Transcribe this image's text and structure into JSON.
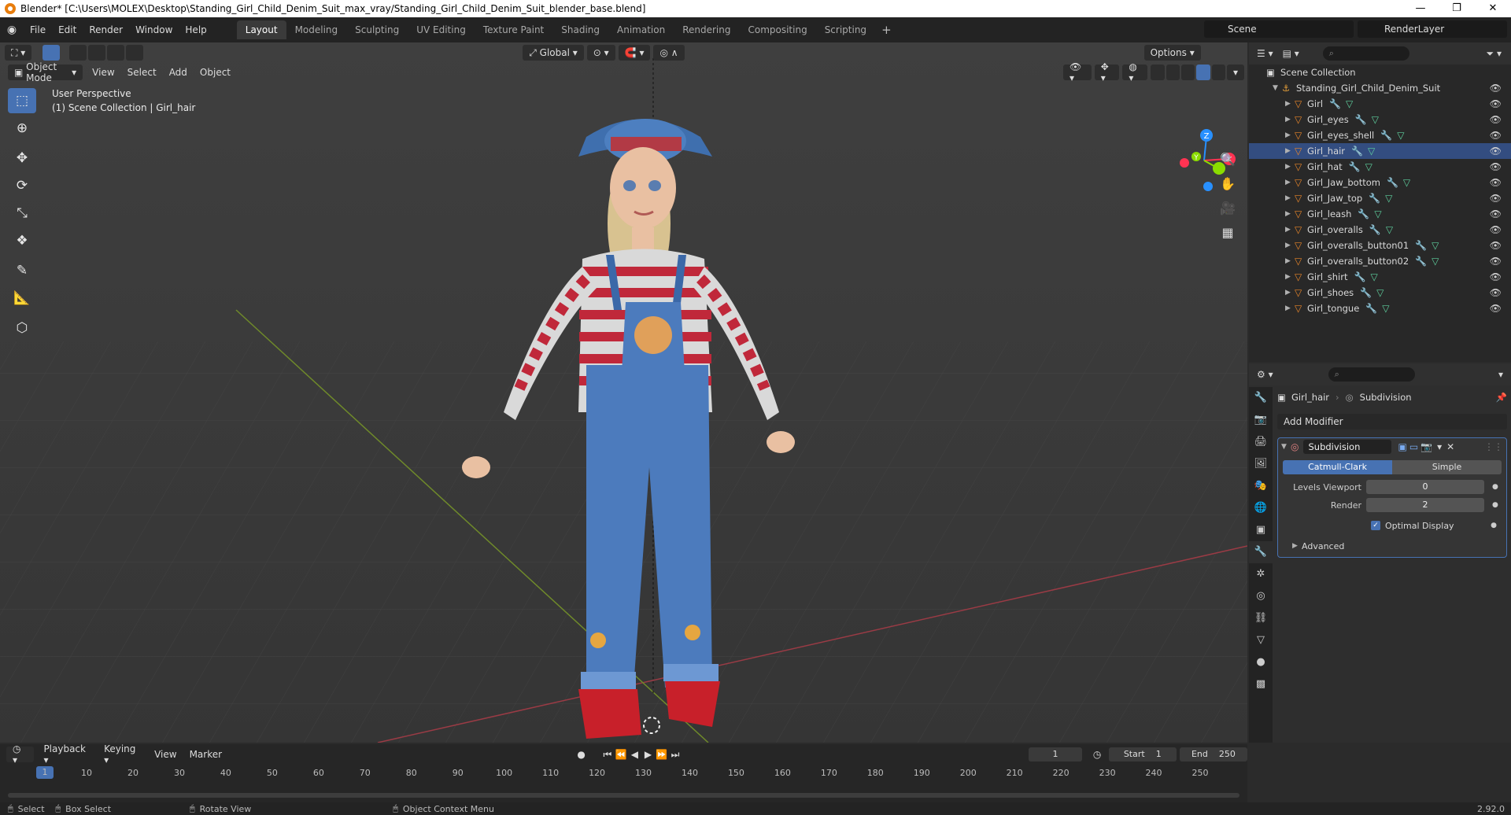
{
  "window": {
    "title": "Blender* [C:\\Users\\MOLEX\\Desktop\\Standing_Girl_Child_Denim_Suit_max_vray/Standing_Girl_Child_Denim_Suit_blender_base.blend]",
    "controls": [
      "—",
      "❐",
      "✕"
    ]
  },
  "menu": [
    "File",
    "Edit",
    "Render",
    "Window",
    "Help"
  ],
  "workspaces": [
    {
      "label": "Layout",
      "active": true
    },
    {
      "label": "Modeling"
    },
    {
      "label": "Sculpting"
    },
    {
      "label": "UV Editing"
    },
    {
      "label": "Texture Paint"
    },
    {
      "label": "Shading"
    },
    {
      "label": "Animation"
    },
    {
      "label": "Rendering"
    },
    {
      "label": "Compositing"
    },
    {
      "label": "Scripting"
    }
  ],
  "scene": {
    "name": "Scene"
  },
  "render_layer": {
    "name": "RenderLayer"
  },
  "viewport": {
    "mode": "Object Mode",
    "menus": [
      "View",
      "Select",
      "Add",
      "Object"
    ],
    "transform_orientation": "Global",
    "options_label": "Options",
    "info_line1": "User Perspective",
    "info_line2": "(1) Scene Collection | Girl_hair",
    "gizmo_axes": {
      "x": "X",
      "y": "Y",
      "z": "Z"
    }
  },
  "outliner": {
    "root": "Scene Collection",
    "collection": "Standing_Girl_Child_Denim_Suit",
    "objects": [
      "Girl",
      "Girl_eyes",
      "Girl_eyes_shell",
      "Girl_hair",
      "Girl_hat",
      "Girl_Jaw_bottom",
      "Girl_Jaw_top",
      "Girl_leash",
      "Girl_overalls",
      "Girl_overalls_button01",
      "Girl_overalls_button02",
      "Girl_shirt",
      "Girl_shoes",
      "Girl_tongue"
    ],
    "selected": "Girl_hair"
  },
  "properties": {
    "object": "Girl_hair",
    "modifier_crumb": "Subdivision",
    "add_modifier": "Add Modifier",
    "modifier": {
      "name": "Subdivision",
      "mode_on": "Catmull-Clark",
      "mode_off": "Simple",
      "levels_viewport_label": "Levels Viewport",
      "levels_viewport": "0",
      "render_label": "Render",
      "render": "2",
      "optimal_display": "Optimal Display",
      "advanced": "Advanced"
    }
  },
  "timeline": {
    "menus": [
      "Playback",
      "Keying",
      "View",
      "Marker"
    ],
    "current_frame": "1",
    "start_label": "Start",
    "start": "1",
    "end_label": "End",
    "end": "250",
    "ruler": [
      "1",
      "10",
      "20",
      "30",
      "40",
      "50",
      "60",
      "70",
      "80",
      "90",
      "100",
      "110",
      "120",
      "130",
      "140",
      "150",
      "160",
      "170",
      "180",
      "190",
      "200",
      "210",
      "220",
      "230",
      "240",
      "250"
    ]
  },
  "statusbar": {
    "select": "Select",
    "box_select": "Box Select",
    "rotate_view": "Rotate View",
    "context_menu": "Object Context Menu",
    "version": "2.92.0"
  },
  "colors": {
    "accent": "#4772b3",
    "mesh_icon": "#e8852a",
    "modifier_icon": "#6a9de8",
    "data_icon": "#5fd19f",
    "axis_x": "#ff3352",
    "axis_y": "#8bdc00",
    "axis_z": "#2890ff"
  }
}
